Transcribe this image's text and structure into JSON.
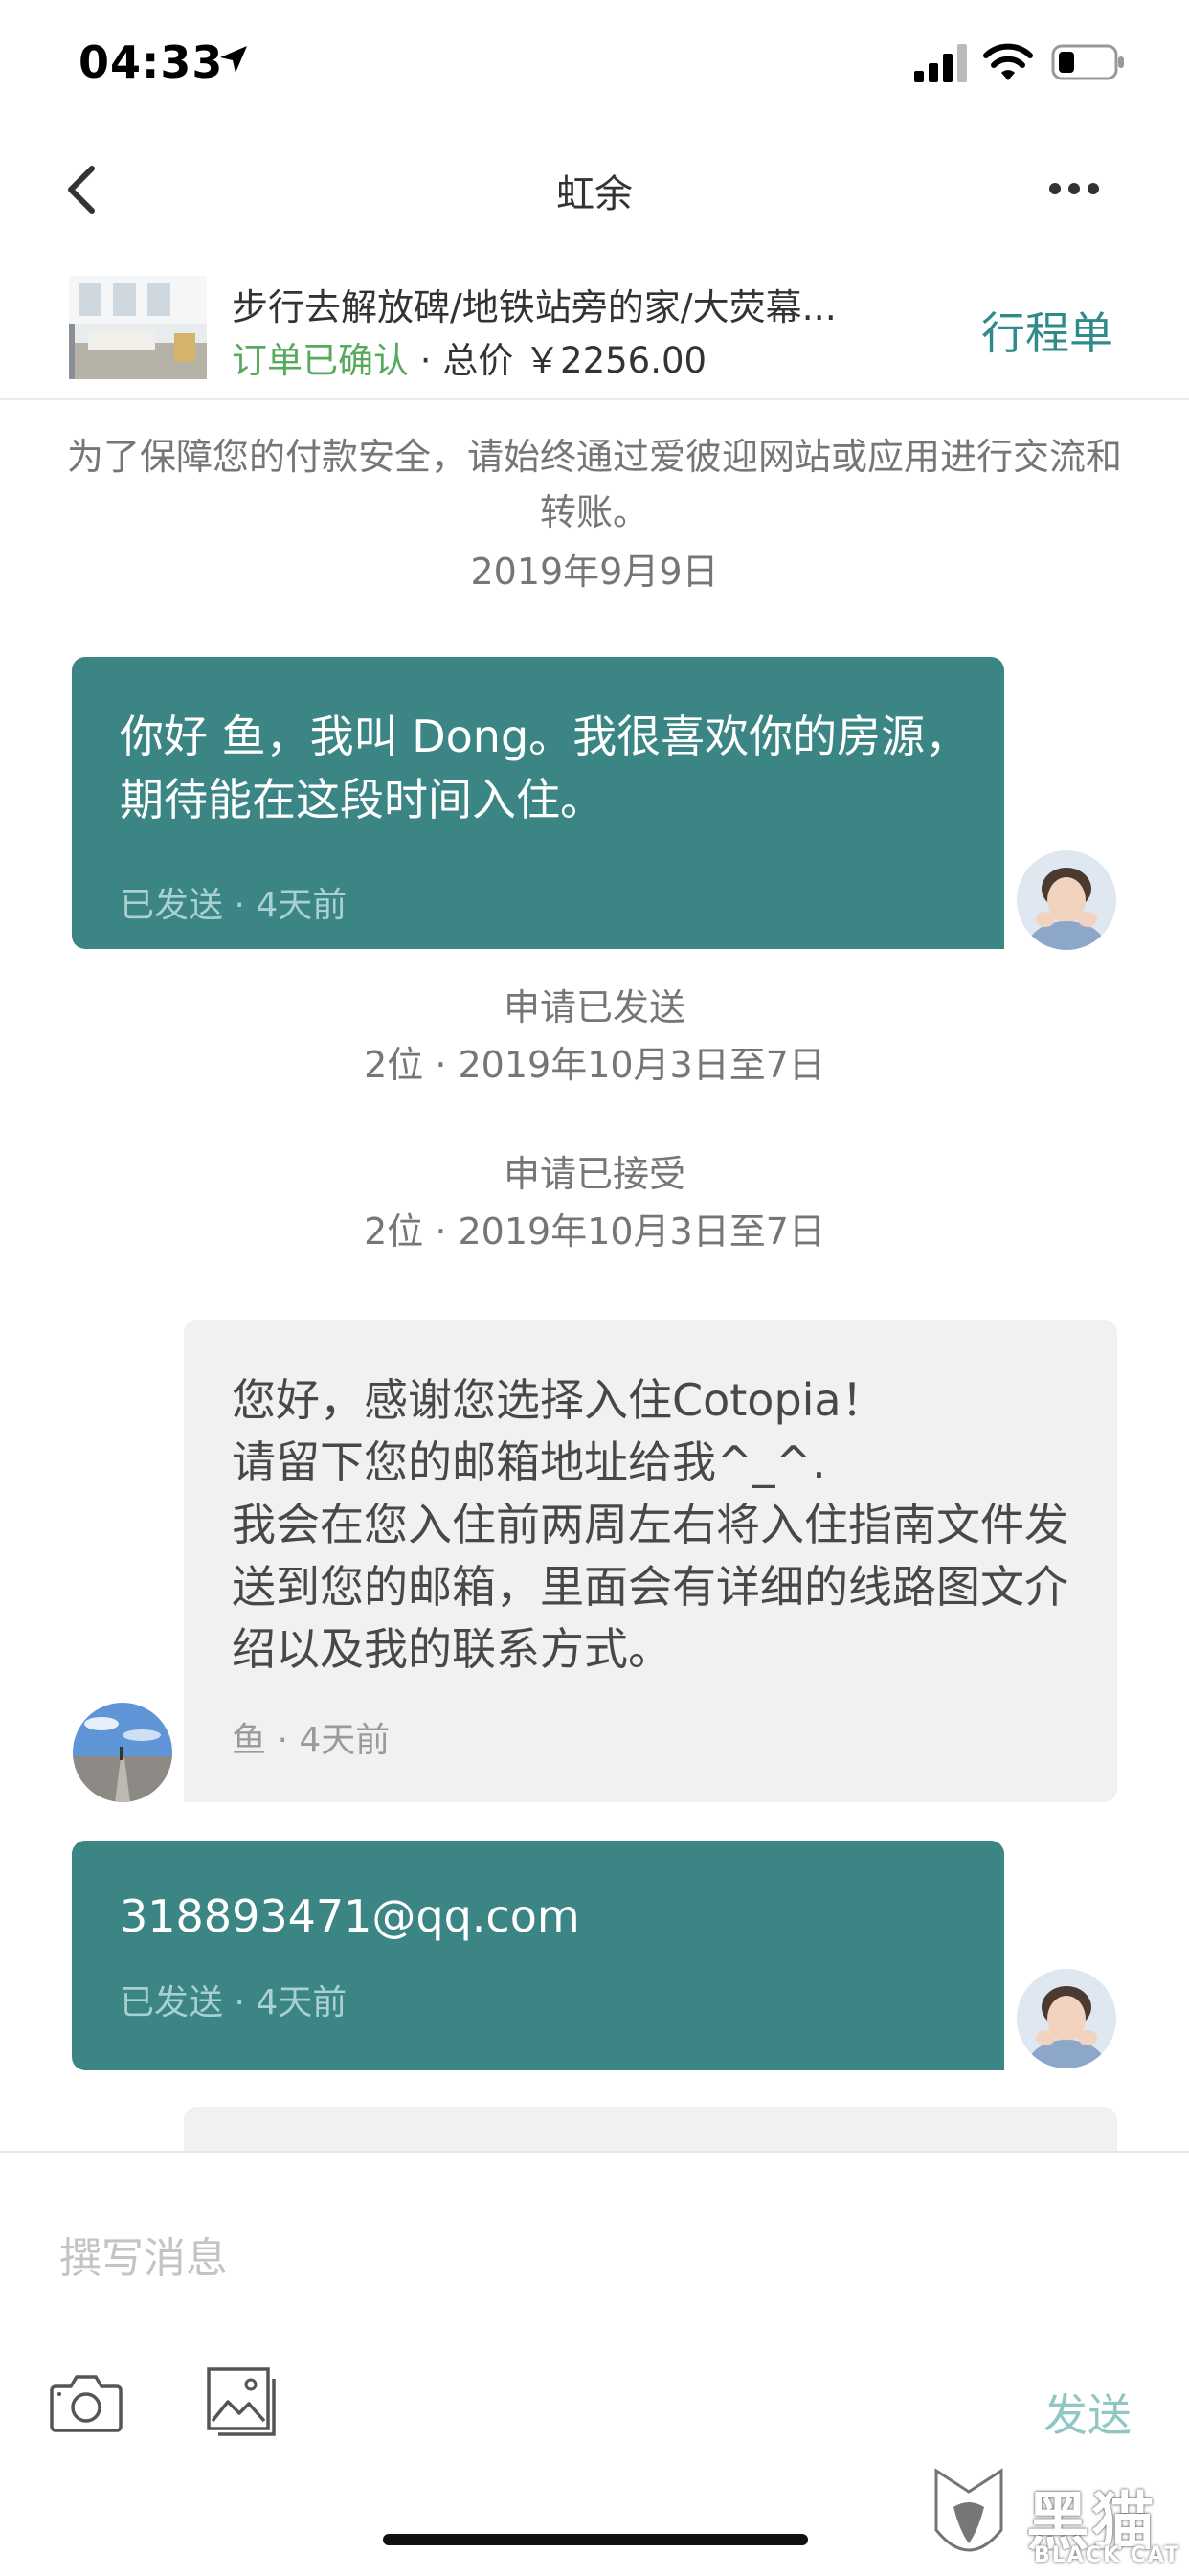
{
  "status_bar": {
    "time": "04:33"
  },
  "nav": {
    "title": "虹余"
  },
  "listing": {
    "title": "步行去解放碑/地铁站旁的家/大荧幕...",
    "status": "订单已确认",
    "price_sep": " · 总价 ",
    "price": "￥2256.00",
    "itinerary": "行程单"
  },
  "notice": {
    "text": "为了保障您的付款安全，请始终通过爱彼迎网站或应用进行交流和转账。",
    "date": "2019年9月9日"
  },
  "messages": [
    {
      "sender": "me",
      "text": "你好 鱼，我叫 Dong。我很喜欢你的房源，期待能在这段时间入住。",
      "meta": "已发送 · 4天前"
    },
    {
      "sender": "them",
      "text": "您好，感谢您选择入住Cotopia！\n请留下您的邮箱地址给我^_^.\n我会在您入住前两周左右将入住指南文件发送到您的邮箱，里面会有详细的线路图文介绍以及我的联系方式。",
      "meta": "鱼 · 4天前"
    },
    {
      "sender": "me",
      "text": "318893471@qq.com",
      "meta": "已发送 · 4天前"
    }
  ],
  "system_events": [
    {
      "title": "申请已发送",
      "detail": "2位 · 2019年10月3日至7日"
    },
    {
      "title": "申请已接受",
      "detail": "2位 · 2019年10月3日至7日"
    }
  ],
  "composer": {
    "placeholder": "撰写消息",
    "send_label": "发送"
  },
  "watermark": {
    "text": "黑猫",
    "subtext": "BLACK CAT"
  },
  "colors": {
    "accent": "#3b8585",
    "status_green": "#57a95c",
    "link_teal": "#2f8a8a"
  },
  "icons": [
    "location-arrow-icon",
    "signal-icon",
    "wifi-icon",
    "battery-icon",
    "back-chevron-icon",
    "more-dots-icon",
    "camera-icon",
    "gallery-icon"
  ]
}
